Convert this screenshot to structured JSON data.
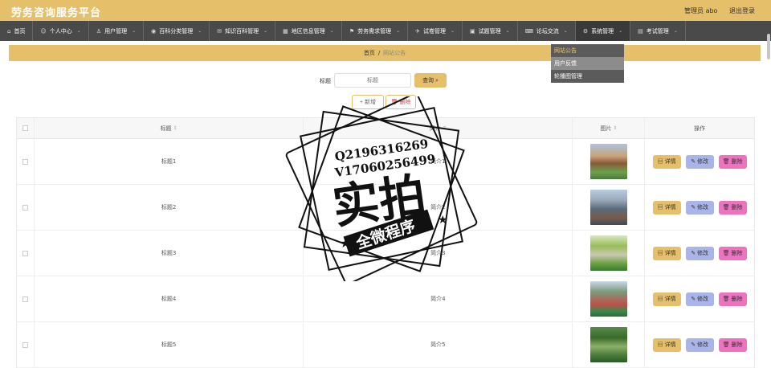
{
  "header": {
    "title": "劳务咨询服务平台",
    "user_label": "管理员 abo",
    "logout_label": "退出登录"
  },
  "nav": [
    {
      "label": "首页",
      "icon": "home-icon",
      "glyph": "⌂",
      "has_dropdown": false
    },
    {
      "label": "个人中心",
      "icon": "user-icon",
      "glyph": "☺",
      "has_dropdown": true
    },
    {
      "label": "用户管理",
      "icon": "user-manage-icon",
      "glyph": "♙",
      "has_dropdown": true
    },
    {
      "label": "百科分类管理",
      "icon": "category-icon",
      "glyph": "◉",
      "has_dropdown": true
    },
    {
      "label": "知识百科管理",
      "icon": "book-icon",
      "glyph": "✉",
      "has_dropdown": true
    },
    {
      "label": "地区信息管理",
      "icon": "region-icon",
      "glyph": "▦",
      "has_dropdown": true
    },
    {
      "label": "劳务需求管理",
      "icon": "demand-icon",
      "glyph": "⚑",
      "has_dropdown": true
    },
    {
      "label": "试卷管理",
      "icon": "paper-icon",
      "glyph": "✈",
      "has_dropdown": true
    },
    {
      "label": "试题管理",
      "icon": "question-icon",
      "glyph": "▣",
      "has_dropdown": true
    },
    {
      "label": "论坛交流",
      "icon": "forum-icon",
      "glyph": "⌨",
      "has_dropdown": true
    },
    {
      "label": "系统管理",
      "icon": "system-icon",
      "glyph": "⚙",
      "has_dropdown": true
    },
    {
      "label": "考试管理",
      "icon": "exam-icon",
      "glyph": "▤",
      "has_dropdown": true
    }
  ],
  "dropdown": [
    "网站公告",
    "用户反馈",
    "轮播图管理"
  ],
  "breadcrumb": {
    "home": "首页",
    "separator": "/",
    "current": "网站公告"
  },
  "search": {
    "label": "标题",
    "placeholder": "标题",
    "button": "查询 ⌕"
  },
  "actions": {
    "add": "+ 新增",
    "delete": "🗑 删除"
  },
  "table": {
    "headers": {
      "title": "标题",
      "intro": "简介",
      "image": "图片",
      "ops": "操作"
    },
    "rows": [
      {
        "title": "标题1",
        "intro": "简介1",
        "image": "t1"
      },
      {
        "title": "标题2",
        "intro": "简介2",
        "image": "t2"
      },
      {
        "title": "标题3",
        "intro": "简介3",
        "image": "t3"
      },
      {
        "title": "标题4",
        "intro": "简介4",
        "image": "t4"
      },
      {
        "title": "标题5",
        "intro": "简介5",
        "image": "t5"
      }
    ],
    "op_labels": {
      "detail": "▤ 详情",
      "edit": "✎ 修改",
      "delete": "🗑 删除"
    }
  },
  "watermark": {
    "line1": "Q2196316269",
    "line2": "V17060256499",
    "big": "实拍",
    "banner": "全微程序"
  },
  "colors": {
    "accent": "#e6bf6a",
    "nav_bg": "#4a4a4a",
    "edit": "#a9b5e8",
    "delete": "#ee72c0"
  }
}
